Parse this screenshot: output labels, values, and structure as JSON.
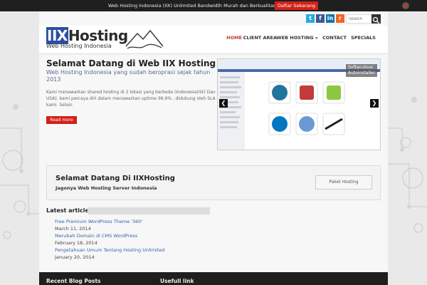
{
  "topbar": {
    "message": "Web Hosting Indonesia (IIX) Unlimited Bandwidth Murah dan Berkualitas",
    "cta_label": "Daftar Sekarang"
  },
  "social": {
    "icons": [
      "twitter-icon",
      "facebook-icon",
      "linkedin-icon",
      "rss-icon"
    ],
    "letters": [
      "t",
      "f",
      "in",
      "r"
    ],
    "colors": [
      "#2aa9e0",
      "#3b5998",
      "#0e76a8",
      "#f26522"
    ]
  },
  "search": {
    "placeholder": "Search"
  },
  "logo": {
    "brand_iix": "IIX",
    "brand_rest": "Hosting",
    "tagline": "Web Hosting Indonesia"
  },
  "nav": {
    "items": [
      "HOME",
      "CLIENT AREA",
      "WEB HOSTING »",
      "CONTACT",
      "SPECIALS"
    ]
  },
  "hero": {
    "title": "Selamat Datang di Web IIX Hosting",
    "subtitle": "Web Hosting Indonesia yang sudah beroprasi sejak tahun 2013",
    "text": "Kami menawarkan shared hosting di 2 lokasi yang berbeda (Indonesia(IIX) Dan USA). kami percaya diri dalam menawarkan uptime 99,9% , didukung oleh SLA kami. Selain",
    "readmore": "Read more"
  },
  "slider": {
    "caption": "Softaculous Autoinstaller",
    "prev": "❮",
    "next": "❯"
  },
  "welcome": {
    "title": "Selamat Datang Di IIXHosting",
    "subtitle": "Jagonya Web Hosting Server Indonesia",
    "button": "Paket Hosting"
  },
  "latest": {
    "heading": "Latest article",
    "articles": [
      {
        "title": "Free Premium WordPress Theme '360'",
        "date": "March 11, 2014"
      },
      {
        "title": "Merubah Domain di CMS WordPress",
        "date": "February 18, 2014"
      },
      {
        "title": "Pengetahuan Umum Tentang Hosting Unlimited",
        "date": "January 20, 2014"
      }
    ]
  },
  "footer": {
    "col1": "Recent Blog Posts",
    "col2": "Usefull link"
  },
  "colors": {
    "accent": "#d3201a",
    "brand_blue": "#2b4fa1",
    "link": "#3366aa"
  }
}
